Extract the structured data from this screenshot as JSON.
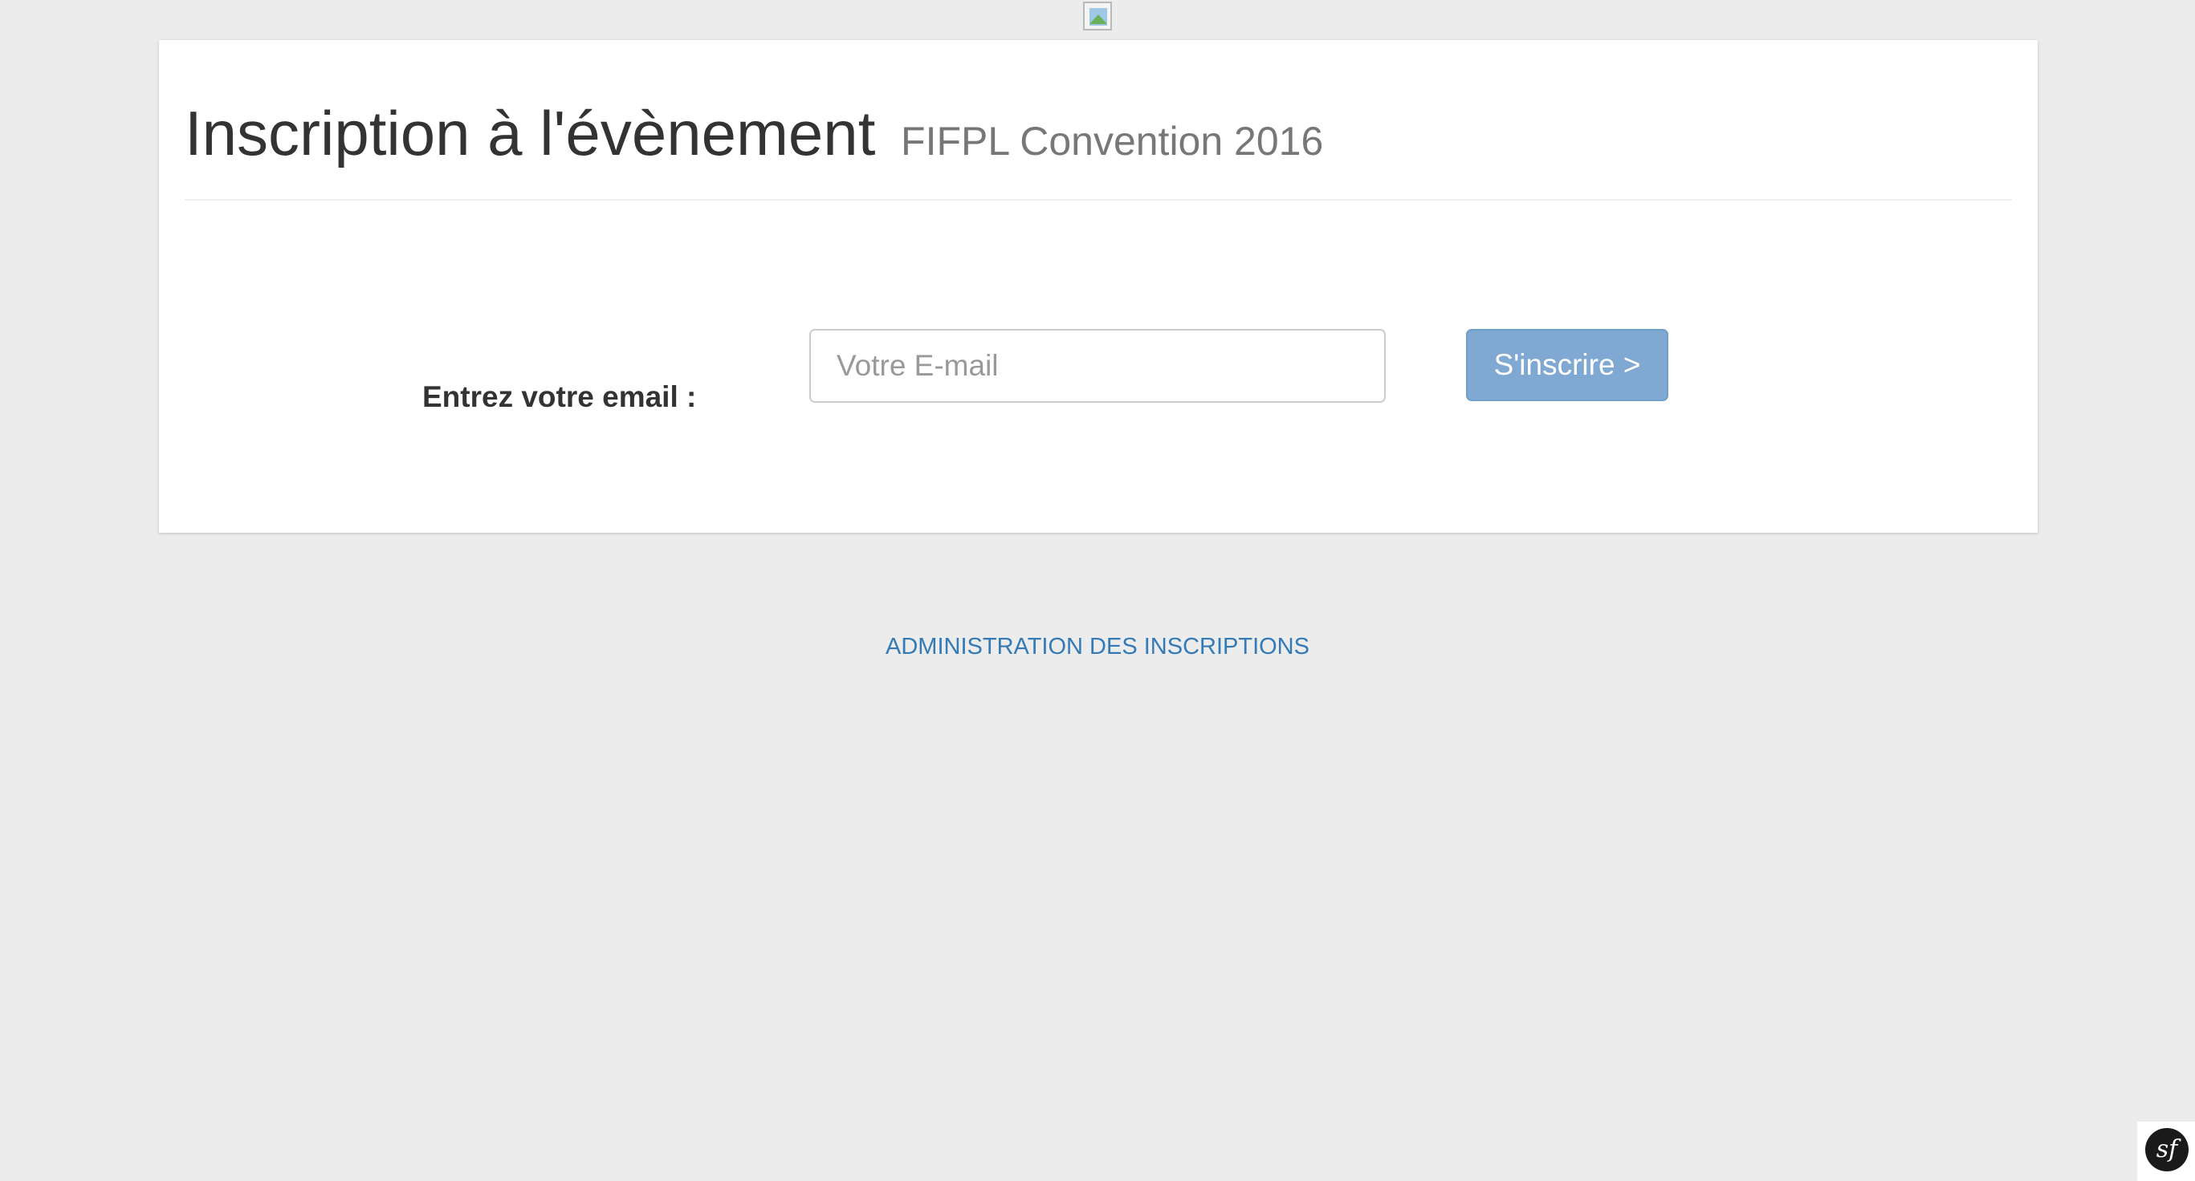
{
  "header": {
    "title": "Inscription à l'évènement",
    "event_name": "FIFPL Convention 2016",
    "logo_icon": "broken-image-icon"
  },
  "form": {
    "email_label": "Entrez votre email :",
    "email_placeholder": "Votre E-mail",
    "email_value": "",
    "submit_label": "S'inscrire >"
  },
  "footer": {
    "admin_link_label": "ADMINISTRATION DES INSCRIPTIONS"
  },
  "toolbar": {
    "symfony_icon": "symfony-logo-icon",
    "symfony_glyph": "sf"
  },
  "colors": {
    "background": "#ececec",
    "button": "#7fa9d2",
    "link": "#337ab7"
  }
}
